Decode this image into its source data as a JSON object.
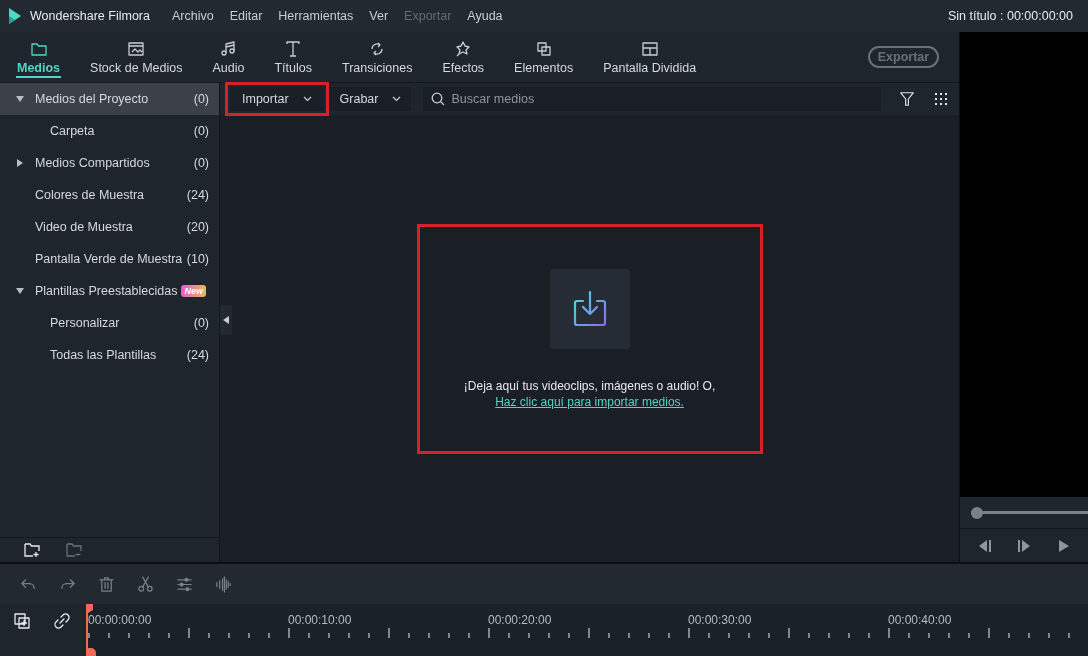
{
  "app": {
    "title": "Wondershare Filmora"
  },
  "menu": [
    {
      "label": "Archivo",
      "disabled": false
    },
    {
      "label": "Editar",
      "disabled": false
    },
    {
      "label": "Herramientas",
      "disabled": false
    },
    {
      "label": "Ver",
      "disabled": false
    },
    {
      "label": "Exportar",
      "disabled": true
    },
    {
      "label": "Ayuda",
      "disabled": false
    }
  ],
  "project_info": "Sin título : 00:00:00:00",
  "tabs": [
    {
      "label": "Medios",
      "selected": true
    },
    {
      "label": "Stock de Medios",
      "selected": false
    },
    {
      "label": "Audio",
      "selected": false
    },
    {
      "label": "Títulos",
      "selected": false
    },
    {
      "label": "Transiciones",
      "selected": false
    },
    {
      "label": "Efectos",
      "selected": false
    },
    {
      "label": "Elementos",
      "selected": false
    },
    {
      "label": "Pantalla Dividida",
      "selected": false
    }
  ],
  "export_button": {
    "label": "Exportar",
    "disabled": true
  },
  "sidebar": {
    "items": [
      {
        "label": "Medios del Proyecto",
        "count": "(0)",
        "kind": "group",
        "expanded": true,
        "selected": true,
        "children": [
          {
            "label": "Carpeta",
            "count": "(0)",
            "kind": "item",
            "selected": false
          }
        ]
      },
      {
        "label": "Medios Compartidos",
        "count": "(0)",
        "kind": "group",
        "expanded": false,
        "selected": false
      },
      {
        "label": "Colores de Muestra",
        "count": "(24)",
        "kind": "item",
        "selected": false
      },
      {
        "label": "Video de Muestra",
        "count": "(20)",
        "kind": "item",
        "selected": false
      },
      {
        "label": "Pantalla Verde de Muestra",
        "count": "(10)",
        "kind": "item",
        "selected": false
      },
      {
        "label": "Plantillas Preestablecidas",
        "badge": "New",
        "kind": "group",
        "expanded": true,
        "selected": false,
        "children": [
          {
            "label": "Personalizar",
            "count": "(0)",
            "kind": "item",
            "selected": false
          },
          {
            "label": "Todas las Plantillas",
            "count": "(24)",
            "kind": "item",
            "selected": false
          }
        ]
      }
    ]
  },
  "media_toolbar": {
    "import_button": {
      "label": "Importar",
      "highlighted": true
    },
    "record_button": {
      "label": "Grabar"
    },
    "search": {
      "placeholder": "Buscar medios"
    }
  },
  "drop_zone": {
    "highlighted": true,
    "message": "¡Deja aquí tus videoclips, imágenes o audio! O,",
    "link": "Haz clic aquí para importar medios."
  },
  "preview": {
    "progress": {
      "level": 0
    }
  },
  "timeline": {
    "ruler_labels": [
      "00:00:00:00",
      "00:00:10:00",
      "00:00:20:00",
      "00:00:30:00",
      "00:00:40:00"
    ]
  }
}
